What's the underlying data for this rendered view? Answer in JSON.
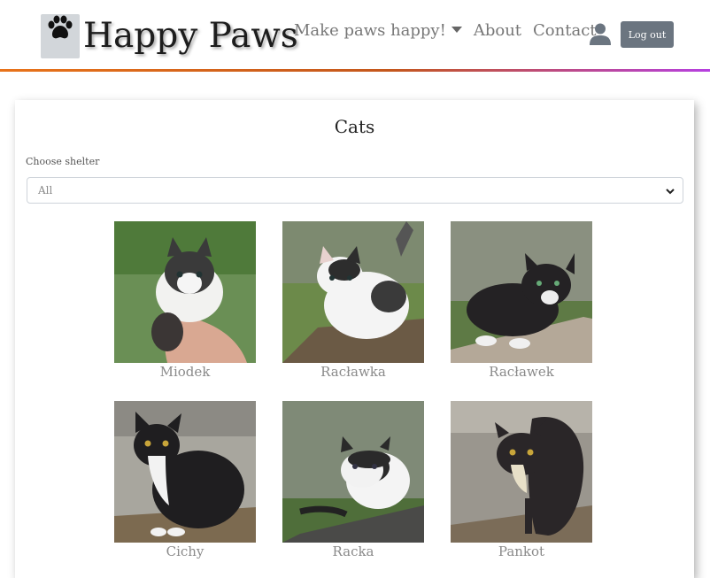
{
  "brand": {
    "name": "Happy Paws"
  },
  "nav": {
    "links": [
      "Make paws happy!",
      "About",
      "Contact"
    ],
    "logout_label": "Log out"
  },
  "main": {
    "title": "Cats",
    "shelter_label": "Choose shelter",
    "shelter_selected": "All"
  },
  "cats": [
    {
      "name": "Miodek",
      "bg": "#4f7a3a"
    },
    {
      "name": "Racławka",
      "bg": "#6c8a4a"
    },
    {
      "name": "Racławek",
      "bg": "#8a9080"
    },
    {
      "name": "Cichy",
      "bg": "#a8a69e"
    },
    {
      "name": "Racka",
      "bg": "#7f8a77"
    },
    {
      "name": "Pankot",
      "bg": "#9a968e"
    }
  ],
  "colors": {
    "accent_line_start": "#e8731a",
    "accent_line_end": "#b640e0",
    "logout_bg": "#6b7580"
  },
  "icons": {
    "logo": "paw-icon",
    "user": "user-icon",
    "dropdown": "chevron-down-icon"
  }
}
